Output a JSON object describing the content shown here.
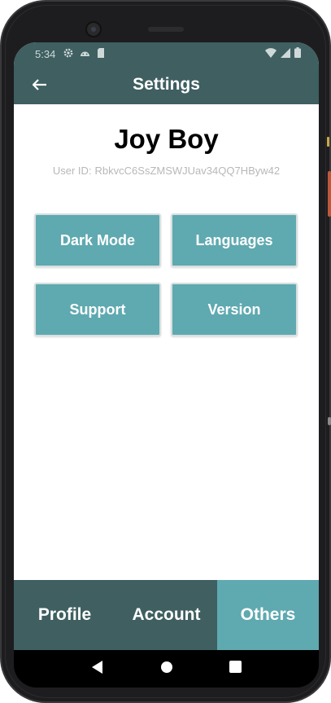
{
  "status_bar": {
    "time": "5:34",
    "icons_left": [
      "gear-icon",
      "android-icon",
      "sd-card-icon"
    ],
    "icons_right": [
      "wifi-icon",
      "signal-icon",
      "battery-icon"
    ]
  },
  "app_bar": {
    "back_icon": "arrow-left-icon",
    "title": "Settings"
  },
  "profile": {
    "name": "Joy Boy",
    "user_id_label": "User ID:",
    "user_id_value": "RbkvcC6SsZMSWJUav34QQ7HByw42"
  },
  "settings_buttons": {
    "dark_mode": "Dark Mode",
    "languages": "Languages",
    "support": "Support",
    "version": "Version"
  },
  "tabs": [
    {
      "label": "Profile",
      "active": false
    },
    {
      "label": "Account",
      "active": false
    },
    {
      "label": "Others",
      "active": true
    }
  ],
  "nav_bar": [
    "back-triangle-icon",
    "home-circle-icon",
    "recents-square-icon"
  ],
  "colors": {
    "primary_dark": "#3f5f61",
    "accent": "#5fa9b0",
    "background": "#ffffff",
    "muted_text": "#b8b8b8"
  }
}
